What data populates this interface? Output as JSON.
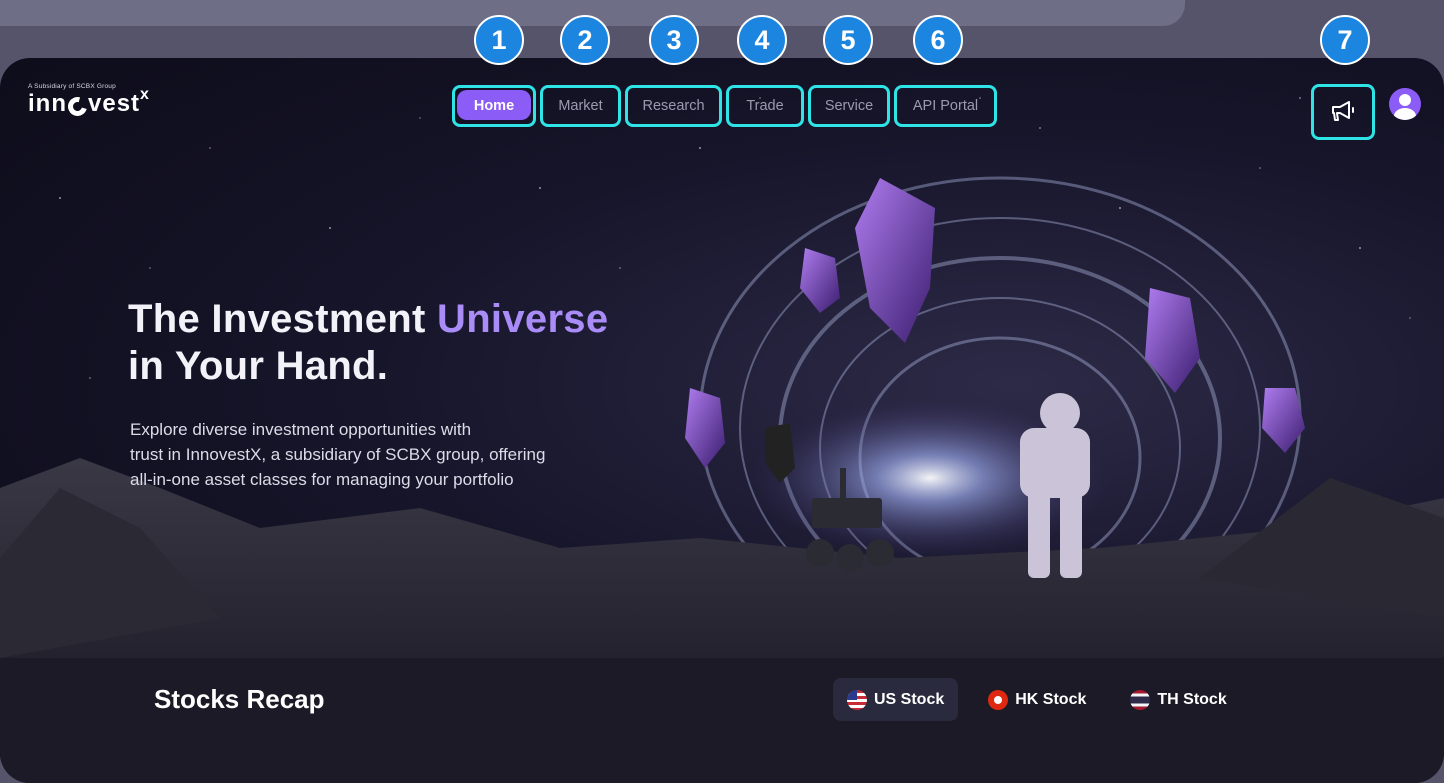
{
  "brand": {
    "subtitle": "A Subsidiary of SCBX Group",
    "name_prefix": "inn",
    "name_suffix": "vest",
    "name_sup": "x"
  },
  "nav": {
    "items": [
      {
        "label": "Home",
        "active": true
      },
      {
        "label": "Market"
      },
      {
        "label": "Research"
      },
      {
        "label": "Trade"
      },
      {
        "label": "Service"
      },
      {
        "label": "API Portal"
      }
    ]
  },
  "badges": [
    "1",
    "2",
    "3",
    "4",
    "5",
    "6",
    "7"
  ],
  "icons": {
    "announce": "megaphone-icon",
    "avatar": "user-avatar-icon"
  },
  "hero": {
    "title_line1_plain": "The Investment ",
    "title_line1_accent": "Universe",
    "title_line2": "in Your Hand.",
    "description_line1": "Explore diverse investment opportunities with",
    "description_line2": "trust in InnovestX, a subsidiary of SCBX group, offering",
    "description_line3": "all-in-one asset classes for managing your portfolio"
  },
  "stocks": {
    "title": "Stocks Recap",
    "tabs": [
      {
        "label": "US Stock",
        "active": true
      },
      {
        "label": "HK Stock"
      },
      {
        "label": "TH Stock"
      }
    ]
  },
  "colors": {
    "accent": "#8c5cf6",
    "highlight": "#2ee4e6",
    "badge": "#1b85e0"
  }
}
